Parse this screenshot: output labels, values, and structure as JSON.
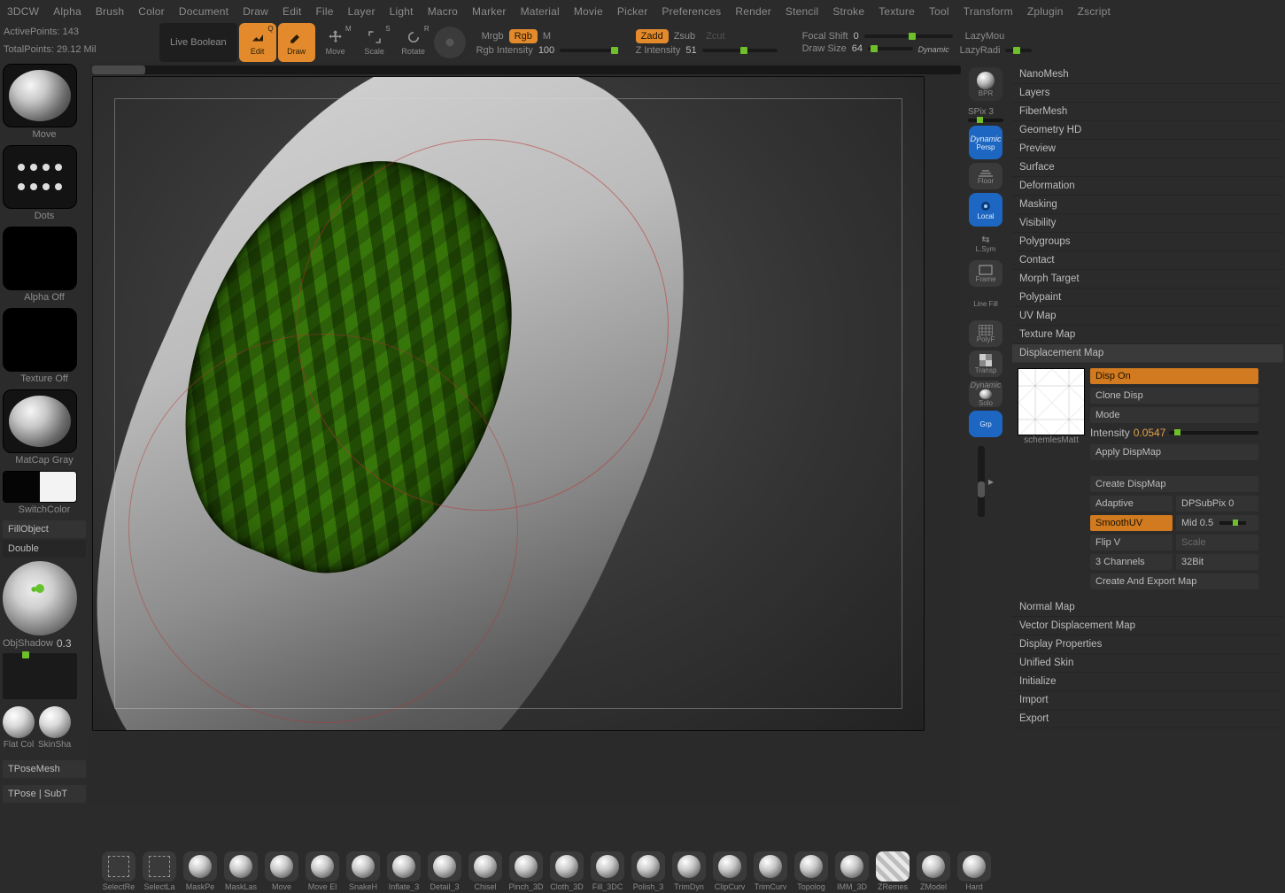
{
  "menu": [
    "3DCW",
    "Alpha",
    "Brush",
    "Color",
    "Document",
    "Draw",
    "Edit",
    "File",
    "Layer",
    "Light",
    "Macro",
    "Marker",
    "Material",
    "Movie",
    "Picker",
    "Preferences",
    "Render",
    "Stencil",
    "Stroke",
    "Texture",
    "Tool",
    "Transform",
    "Zplugin",
    "Zscript"
  ],
  "stats": {
    "active_label": "ActivePoints:",
    "active_value": "143",
    "total_label": "TotalPoints:",
    "total_value": "29.12 Mil"
  },
  "top": {
    "live": "Live Boolean",
    "edit": "Edit",
    "draw": "Draw",
    "move": "Move",
    "scale": "Scale",
    "rotate": "Rotate",
    "mrgb": "Mrgb",
    "rgb": "Rgb",
    "m": "M",
    "zadd": "Zadd",
    "zsub": "Zsub",
    "zcut": "Zcut",
    "rgb_intensity_label": "Rgb Intensity",
    "rgb_intensity_value": "100",
    "z_intensity_label": "Z Intensity",
    "z_intensity_value": "51",
    "focal_label": "Focal Shift",
    "focal_value": "0",
    "drawsize_label": "Draw Size",
    "drawsize_value": "64",
    "dynamic": "Dynamic",
    "lazymouse": "LazyMou",
    "lazyradius": "LazyRadi"
  },
  "left": {
    "brush": "Move",
    "stroke": "Dots",
    "alpha": "Alpha Off",
    "texture": "Texture Off",
    "material": "MatCap Gray",
    "switchcolor": "SwitchColor",
    "fillobject": "FillObject",
    "double": "Double",
    "obj_shadow_label": "ObjShadow",
    "obj_shadow_value": "0.3",
    "flatcol": "Flat Col",
    "skinsha": "SkinSha",
    "tpose": "TPoseMesh",
    "tposesub": "TPose | SubT"
  },
  "quick": {
    "bpr": "BPR",
    "spix_label": "SPix",
    "spix_value": "3",
    "dynamic": "Dynamic",
    "persp": "Persp",
    "floor": "Floor",
    "local": "Local",
    "lsym": "L.Sym",
    "frame": "Frame",
    "linefill": "Line Fill",
    "polyf": "PolyF",
    "transp": "Transp",
    "solo_dyn": "Dynamic",
    "solo": "Solo",
    "grp": "Grp"
  },
  "accordion": [
    "NanoMesh",
    "Layers",
    "FiberMesh",
    "Geometry HD",
    "Preview",
    "Surface",
    "Deformation",
    "Masking",
    "Visibility",
    "Polygroups",
    "Contact",
    "Morph Target",
    "Polypaint",
    "UV Map",
    "Texture Map",
    "Displacement Map",
    "Normal Map",
    "Vector Displacement Map",
    "Display Properties",
    "Unified Skin",
    "Initialize",
    "Import",
    "Export"
  ],
  "disp": {
    "tex_label": "schemlesMatt",
    "disp_on": "Disp On",
    "clone": "Clone Disp",
    "mode": "Mode",
    "intensity_label": "Intensity",
    "intensity_value": "0.0547",
    "apply": "Apply DispMap",
    "create": "Create DispMap",
    "adaptive": "Adaptive",
    "dpsubpix_label": "DPSubPix",
    "dpsubpix_value": "0",
    "smoothuv": "SmoothUV",
    "mid_label": "Mid",
    "mid_value": "0.5",
    "flipv": "Flip V",
    "scale": "Scale",
    "threech": "3 Channels",
    "bit32": "32Bit",
    "create_export": "Create And Export Map"
  },
  "brushes": [
    {
      "n": "SelectRe",
      "t": "square"
    },
    {
      "n": "SelectLa",
      "t": "square"
    },
    {
      "n": "MaskPe",
      "t": "ball"
    },
    {
      "n": "MaskLas",
      "t": "ball"
    },
    {
      "n": "Move",
      "t": "ball"
    },
    {
      "n": "Move El",
      "t": "ball"
    },
    {
      "n": "SnakeH",
      "t": "ball"
    },
    {
      "n": "Inflate_3",
      "t": "ball"
    },
    {
      "n": "Detail_3",
      "t": "ball"
    },
    {
      "n": "Chisel",
      "t": "ball"
    },
    {
      "n": "Pinch_3D",
      "t": "ball"
    },
    {
      "n": "Cloth_3D",
      "t": "ball"
    },
    {
      "n": "Fill_3DC",
      "t": "ball"
    },
    {
      "n": "Polish_3",
      "t": "ball"
    },
    {
      "n": "TrimDyn",
      "t": "ball"
    },
    {
      "n": "ClipCurv",
      "t": "ball"
    },
    {
      "n": "TrimCurv",
      "t": "ball"
    },
    {
      "n": "Topolog",
      "t": "ball"
    },
    {
      "n": "IMM_3D",
      "t": "ball"
    },
    {
      "n": "ZRemes",
      "t": "squareCk"
    },
    {
      "n": "ZModel",
      "t": "ball"
    },
    {
      "n": "Hard",
      "t": "ball"
    }
  ]
}
